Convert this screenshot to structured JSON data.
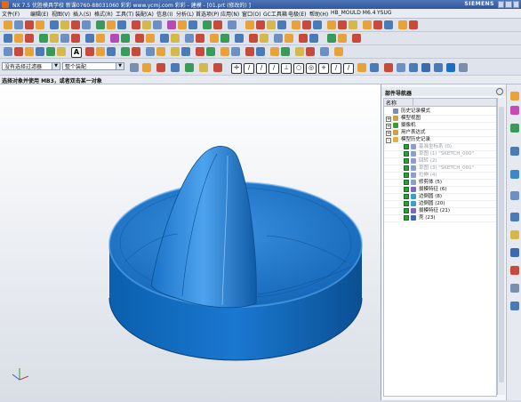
{
  "window": {
    "title": "NX 7.5 优胜模具学校 新课0760-88031060 彩彩 www.ycmj.com 彩彩 - 建模 - [01.prt (修改的) ]",
    "brand": "SIEMENS"
  },
  "menu": [
    "文件(F)",
    "编辑(E)",
    "视图(V)",
    "插入(S)",
    "格式(R)",
    "工具(T)",
    "装配(A)",
    "信息(I)",
    "分析(L)",
    "首选项(P)",
    "应用(N)",
    "窗口(O)",
    "GC工具箱",
    "电极(E)",
    "帮助(H)",
    "HB_MOULD M6.4",
    "YSUG"
  ],
  "toolbar": {
    "filter_select": "没有选择过滤器",
    "assembly_select": "整个装配"
  },
  "status": {
    "prompt": "选择对象并使用 MB3，或者双击某一对象"
  },
  "navigator": {
    "title": "部件导航器",
    "column_name": "名称",
    "items": [
      {
        "label": "历史记录模式",
        "level": 1,
        "expand": "",
        "color": "#7a8fb0",
        "gray": false,
        "check": false
      },
      {
        "label": "模型视图",
        "level": 1,
        "expand": "+",
        "color": "#c8a24a",
        "gray": false,
        "check": false
      },
      {
        "label": "摄像机",
        "level": 1,
        "expand": "+",
        "color": "#3a9a3a",
        "gray": false,
        "check": false
      },
      {
        "label": "用户表达式",
        "level": 1,
        "expand": "+",
        "color": "#c8a24a",
        "gray": false,
        "check": false
      },
      {
        "label": "模型历史记录",
        "level": 1,
        "expand": "-",
        "color": "#e0b040",
        "gray": false,
        "check": false
      },
      {
        "label": "基准坐标系 (0)",
        "level": 2,
        "expand": "",
        "color": "#8aa0c8",
        "gray": true,
        "check": true
      },
      {
        "label": "草图 (1) \"SKETCH_000\"",
        "level": 2,
        "expand": "",
        "color": "#8aa0c8",
        "gray": true,
        "check": true
      },
      {
        "label": "回转 (2)",
        "level": 2,
        "expand": "",
        "color": "#8aa0c8",
        "gray": true,
        "check": true
      },
      {
        "label": "草图 (3) \"SKETCH_001\"",
        "level": 2,
        "expand": "",
        "color": "#8aa0c8",
        "gray": true,
        "check": true
      },
      {
        "label": "拉伸 (4)",
        "level": 2,
        "expand": "",
        "color": "#8aa0c8",
        "gray": true,
        "check": true
      },
      {
        "label": "修剪体 (5)",
        "level": 2,
        "expand": "",
        "color": "#8aa0c8",
        "gray": false,
        "check": true
      },
      {
        "label": "拔模特征 (6)",
        "level": 2,
        "expand": "",
        "color": "#7b6bb8",
        "gray": false,
        "check": true
      },
      {
        "label": "边倒圆 (8)",
        "level": 2,
        "expand": "",
        "color": "#3aa0c8",
        "gray": false,
        "check": true
      },
      {
        "label": "边倒圆 (20)",
        "level": 2,
        "expand": "",
        "color": "#3aa0c8",
        "gray": false,
        "check": true
      },
      {
        "label": "拔模特征 (21)",
        "level": 2,
        "expand": "",
        "color": "#7b6bb8",
        "gray": false,
        "check": true
      },
      {
        "label": "壳 (23)",
        "level": 2,
        "expand": "",
        "color": "#3a6ab0",
        "gray": false,
        "check": true
      }
    ]
  },
  "colors": {
    "model": "#1a6fc0",
    "model_dark": "#0c4c8c",
    "check": "#2e9c3e",
    "titlebar": "#3d64a8"
  }
}
